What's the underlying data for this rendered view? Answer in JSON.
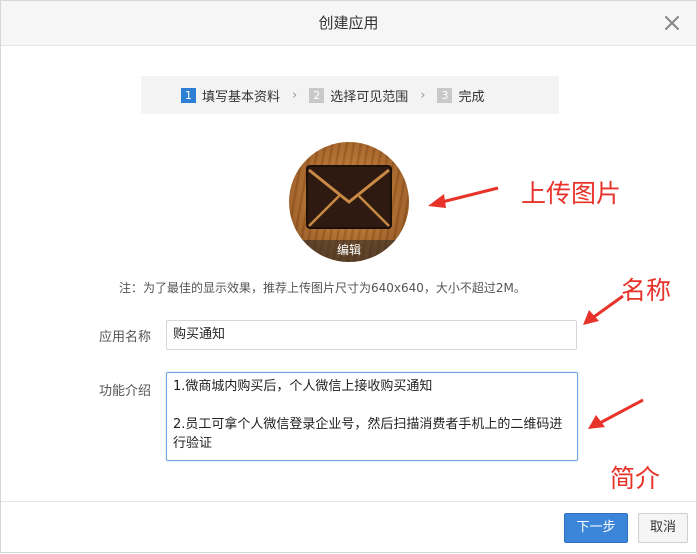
{
  "dialog": {
    "title": "创建应用",
    "close_icon": "close-icon"
  },
  "steps": [
    {
      "num": "1",
      "label": "填写基本资料",
      "active": true
    },
    {
      "num": "2",
      "label": "选择可见范围",
      "active": false
    },
    {
      "num": "3",
      "label": "完成",
      "active": false
    }
  ],
  "avatar": {
    "icon": "envelope-icon",
    "edit_label": "编辑"
  },
  "note": "注：为了最佳的显示效果，推荐上传图片尺寸为640x640，大小不超过2M。",
  "form": {
    "name_label": "应用名称",
    "name_value": "购买通知",
    "desc_label": "功能介绍",
    "desc_value": "1.微商城内购买后，个人微信上接收购买通知\n\n2.员工可拿个人微信登录企业号，然后扫描消费者手机上的二维码进行验证"
  },
  "annotations": {
    "upload": "上传图片",
    "name": "名称",
    "intro": "简介",
    "color": "#e8332a"
  },
  "footer": {
    "next_label": "下一步",
    "cancel_label": "取消"
  },
  "colors": {
    "primary": "#3b86d8",
    "step_active": "#2d7fd3",
    "step_inactive": "#c9c9c9"
  }
}
